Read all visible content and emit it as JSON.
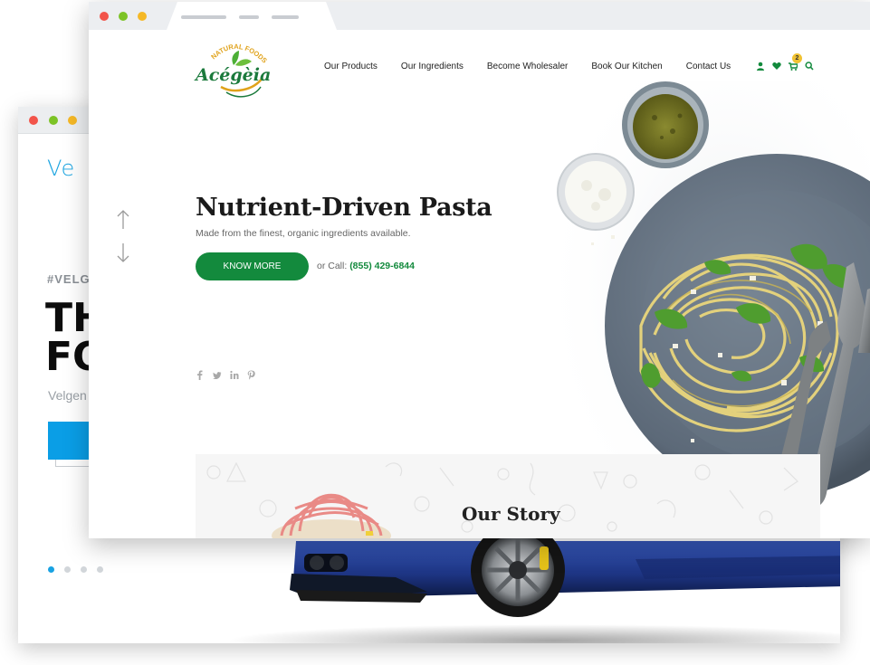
{
  "back_window": {
    "logo_text": "Ve",
    "hashtag": "#VELGE",
    "headline_line1": "TH",
    "headline_line2": "FO",
    "subtitle": "Velgen"
  },
  "front_window": {
    "brand": {
      "name": "Acégèia",
      "tagline": "NATURAL FOODS, LLC"
    },
    "nav": [
      {
        "label": "Our Products"
      },
      {
        "label": "Our Ingredients"
      },
      {
        "label": "Become Wholesaler"
      },
      {
        "label": "Book Our Kitchen"
      },
      {
        "label": "Contact Us"
      }
    ],
    "cart_count": "2",
    "hero": {
      "title": "Nutrient-Driven Pasta",
      "subtitle": "Made from the finest, organic ingredients available.",
      "button": "KNOW MORE",
      "call_prefix": "or Call:",
      "phone": "(855) 429-6844"
    },
    "story": {
      "prefix": "Our",
      "bold": "Story"
    }
  },
  "colors": {
    "brand_green": "#138a3d",
    "accent_blue": "#0a9ee6",
    "badge_yellow": "#f1c232"
  }
}
